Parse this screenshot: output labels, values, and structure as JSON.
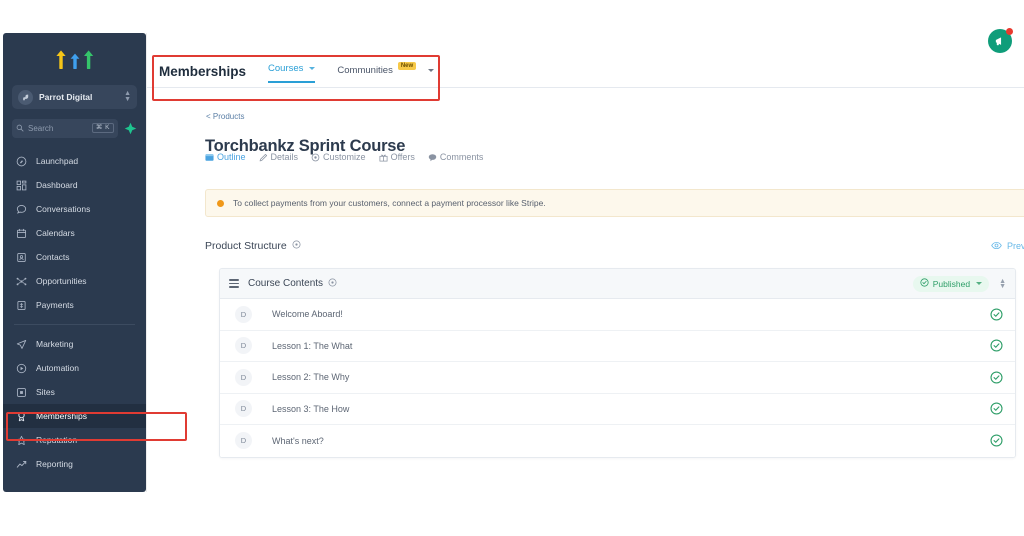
{
  "sidebar": {
    "logo": "triple-arrow-logo",
    "workspace": {
      "name": "Parrot Digital",
      "avatar_icon": "workspace-avatar-icon",
      "switch_icon": "up-down-chevron-icon"
    },
    "search": {
      "placeholder": "Search",
      "shortcut": "⌘ K",
      "icon": "search-icon",
      "ai_icon": "sparkle-icon"
    },
    "groups": [
      {
        "items": [
          {
            "label": "Launchpad",
            "icon": "rocket-icon",
            "active": false
          },
          {
            "label": "Dashboard",
            "icon": "grid-icon",
            "active": false
          },
          {
            "label": "Conversations",
            "icon": "chat-bubble-icon",
            "active": false
          },
          {
            "label": "Calendars",
            "icon": "calendar-icon",
            "active": false
          },
          {
            "label": "Contacts",
            "icon": "contact-card-icon",
            "active": false
          },
          {
            "label": "Opportunities",
            "icon": "funnel-nodes-icon",
            "active": false
          },
          {
            "label": "Payments",
            "icon": "payments-icon",
            "active": false
          }
        ]
      },
      {
        "items": [
          {
            "label": "Marketing",
            "icon": "paper-plane-icon",
            "active": false
          },
          {
            "label": "Automation",
            "icon": "play-circle-icon",
            "active": false
          },
          {
            "label": "Sites",
            "icon": "sites-icon",
            "active": false
          },
          {
            "label": "Memberships",
            "icon": "award-badge-icon",
            "active": true
          },
          {
            "label": "Reputation",
            "icon": "star-icon",
            "active": false
          },
          {
            "label": "Reporting",
            "icon": "trend-line-icon",
            "active": false
          }
        ]
      }
    ]
  },
  "topnav": {
    "title": "Memberships",
    "tabs": [
      {
        "label": "Courses",
        "active": true,
        "badge": "",
        "has_chevron": true
      },
      {
        "label": "Communities",
        "active": false,
        "badge": "New",
        "has_chevron": true
      }
    ]
  },
  "announcement": {
    "icon": "megaphone-icon",
    "has_notification_dot": true
  },
  "page": {
    "breadcrumb": "< Products",
    "title": "Torchbankz Sprint Course",
    "subtabs": [
      {
        "label": "Outline",
        "icon": "outline-icon",
        "active": true
      },
      {
        "label": "Details",
        "icon": "pencil-icon",
        "active": false
      },
      {
        "label": "Customize",
        "icon": "customize-icon",
        "active": false
      },
      {
        "label": "Offers",
        "icon": "gift-icon",
        "active": false
      },
      {
        "label": "Comments",
        "icon": "comment-icon",
        "active": false
      }
    ],
    "notice": {
      "text": "To collect payments from your customers, connect a payment processor like Stripe.",
      "dot_color": "#f09819"
    },
    "structure": {
      "label": "Product Structure",
      "info_icon": "info-circle-icon",
      "preview_label": "Preview",
      "preview_icon": "eye-icon",
      "kebab_icon": "more-vertical-icon"
    }
  },
  "card": {
    "drag_icon": "drag-handle-icon",
    "title": "Course Contents",
    "info_icon": "info-circle-icon",
    "status": {
      "label": "Published",
      "icon": "check-circle-icon",
      "chevron": "chevron-down-icon",
      "color": "#2e9e68"
    },
    "sort_icon": "sort-updown-icon",
    "lessons": [
      {
        "icon_letter": "D",
        "title": "Welcome Aboard!",
        "status_icon": "check-circle-icon"
      },
      {
        "icon_letter": "D",
        "title": "Lesson 1: The What",
        "status_icon": "check-circle-icon"
      },
      {
        "icon_letter": "D",
        "title": "Lesson 2: The Why",
        "status_icon": "check-circle-icon"
      },
      {
        "icon_letter": "D",
        "title": "Lesson 3: The How",
        "status_icon": "check-circle-icon"
      },
      {
        "icon_letter": "D",
        "title": "What's next?",
        "status_icon": "check-circle-icon"
      }
    ]
  },
  "annotations": [
    {
      "name": "topnav-highlight"
    },
    {
      "name": "memberships-highlight"
    }
  ],
  "colors": {
    "sidebar_bg": "#2b3a4f",
    "accent_blue": "#2a9fd6",
    "green": "#2e9e68",
    "amber": "#f7c948",
    "annotation_red": "#e03b33"
  }
}
